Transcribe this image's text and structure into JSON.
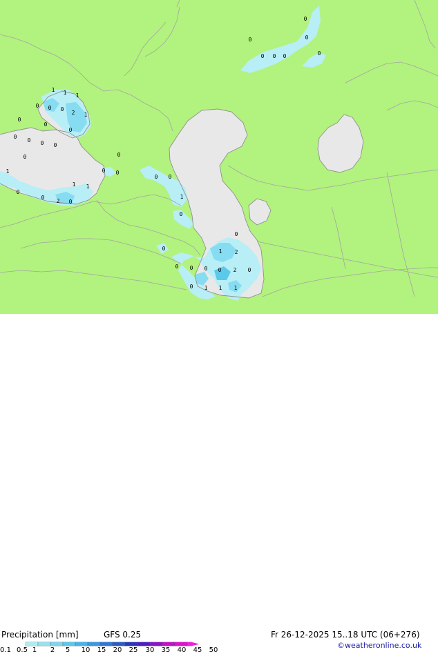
{
  "footer": {
    "title": "Precipitation [mm]",
    "model": "GFS 0.25",
    "valid_time": "Fr 26-12-2025 15..18 UTC (06+276)",
    "credit": "©weatheronline.co.uk"
  },
  "legend": {
    "ticks": [
      "0.1",
      "0.5",
      "1",
      "2",
      "5",
      "10",
      "15",
      "20",
      "25",
      "30",
      "35",
      "40",
      "45",
      "50"
    ],
    "colors": [
      "#aeeef0",
      "#96e2ee",
      "#7fd6ec",
      "#5ec6ea",
      "#48b3e8",
      "#3a97e0",
      "#2f78d6",
      "#2c58c8",
      "#2a36b8",
      "#4a1ec2",
      "#8a12c8",
      "#c010c8",
      "#e010d0",
      "#f020e0"
    ]
  },
  "map": {
    "colors": {
      "land": "#b2f27e",
      "sea": "#e8e8e8",
      "border": "#a4a4a4",
      "coast": "#909090",
      "precip_light": "#b8eef6",
      "precip_mid": "#86dcf0",
      "precip_heavy": "#5cc8ea"
    },
    "value_labels": [
      "0",
      "0",
      "0",
      "0",
      "0",
      "0",
      "0",
      "1",
      "1",
      "1",
      "0",
      "0",
      "0",
      "2",
      "1",
      "0",
      "0",
      "0",
      "0",
      "0",
      "0",
      "0",
      "0",
      "0",
      "0",
      "1",
      "0",
      "1",
      "1",
      "2",
      "0",
      "0",
      "0",
      "0",
      "0",
      "1",
      "0",
      "0",
      "0",
      "1",
      "2",
      "0",
      "0",
      "0",
      "0",
      "2",
      "0",
      "0",
      "1",
      "1",
      "1"
    ]
  }
}
